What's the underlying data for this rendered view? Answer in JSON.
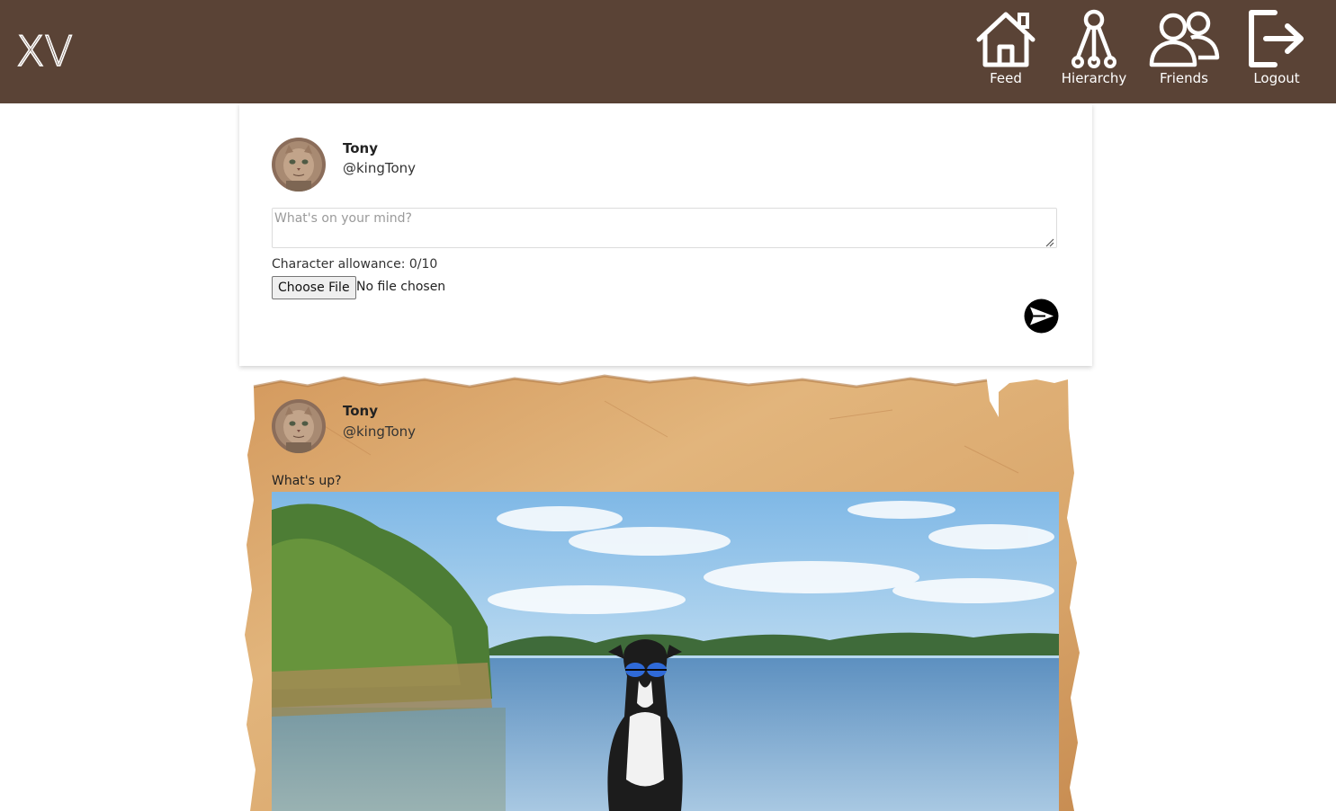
{
  "app": {
    "logo_text": "XV"
  },
  "nav": {
    "items": [
      {
        "label": "Feed",
        "icon": "home-icon"
      },
      {
        "label": "Hierarchy",
        "icon": "hierarchy-icon"
      },
      {
        "label": "Friends",
        "icon": "friends-icon"
      },
      {
        "label": "Logout",
        "icon": "logout-icon"
      }
    ]
  },
  "composer": {
    "user": {
      "name": "Tony",
      "handle": "@kingTony"
    },
    "placeholder": "What's on your mind?",
    "value": "",
    "allowance": "Character allowance: 0/10",
    "file_button": "Choose File",
    "file_status": "No file chosen",
    "send_icon": "send-icon"
  },
  "posts": [
    {
      "user": {
        "name": "Tony",
        "handle": "@kingTony"
      },
      "text": "What's up?",
      "image": "photo of a black and white dog wearing blue sunglasses sitting in a lake"
    }
  ],
  "colors": {
    "header": "#5a4336",
    "parchment": "#d9a66b",
    "send_button": "#000000"
  }
}
